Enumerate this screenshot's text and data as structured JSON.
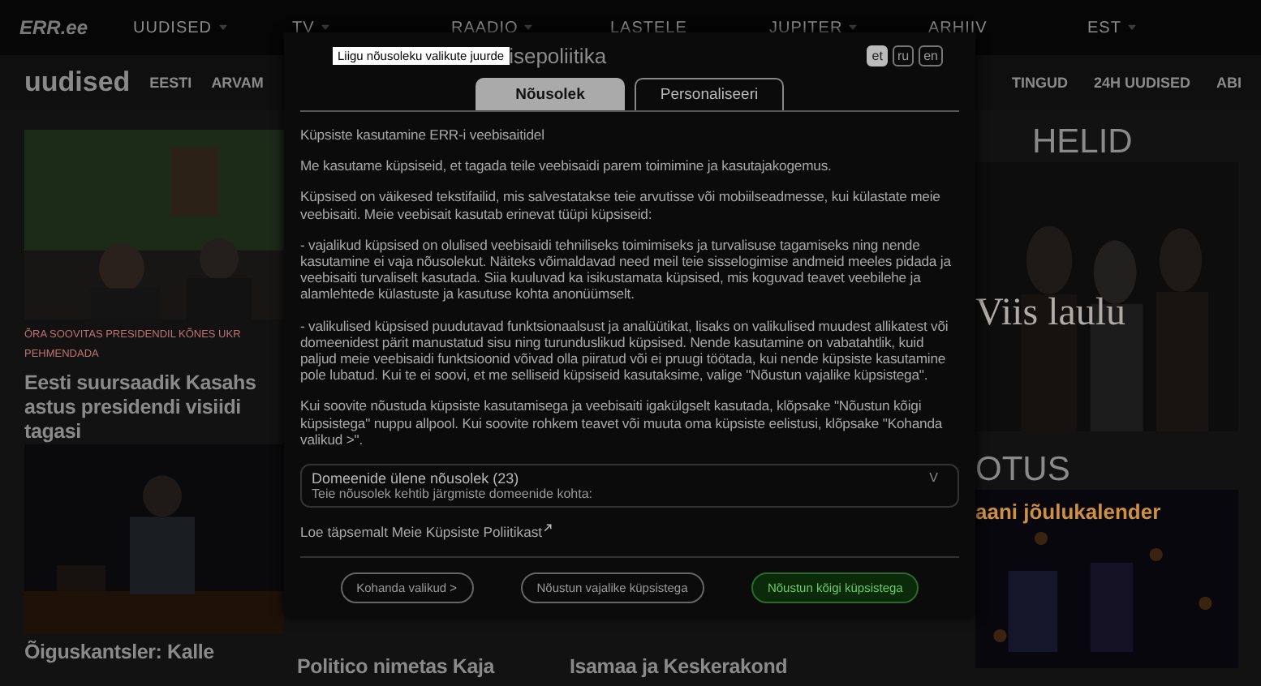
{
  "top_nav": {
    "logo": "ERR.ee",
    "items": [
      {
        "label": "UUDISED",
        "dropdown": true
      },
      {
        "label": "TV",
        "dropdown": true
      },
      {
        "label": "RAADIO",
        "dropdown": true
      },
      {
        "label": "LASTELE",
        "dropdown": false
      },
      {
        "label": "JUPITER",
        "dropdown": true
      },
      {
        "label": "ARHIIV",
        "dropdown": false
      },
      {
        "label": "EST",
        "dropdown": true
      }
    ]
  },
  "section_nav": {
    "title": "uudised",
    "left_items": [
      "EESTI",
      "ARVAM"
    ],
    "right_items": [
      "TINGUD",
      "24H UUDISED",
      "ABI"
    ]
  },
  "articles": {
    "column_1": [
      {
        "kind": "picture"
      },
      {
        "kind": "kicker",
        "text": "ÕRA SOOVITAS PRESIDENDIL KÕNES UKR PEHMENDADA"
      },
      {
        "kind": "headline",
        "text": "Eesti suursaadik Kasahs astus presidendi visiidi tagasi"
      },
      {
        "kind": "picture"
      },
      {
        "kind": "headline",
        "text": "Õiguskantsler: Kalle"
      }
    ],
    "column_2": [
      {
        "kind": "headline",
        "text": "Politico nimetas Kaja"
      }
    ],
    "column_3": [
      {
        "kind": "headline",
        "text": "Isamaa ja Keskerakond"
      }
    ],
    "column_4": [
      {
        "kind": "section",
        "text": "HELID"
      },
      {
        "kind": "picture",
        "caption": "Viis laulu"
      },
      {
        "kind": "section",
        "text": "OTUS"
      },
      {
        "kind": "picture",
        "caption": "aani jõulukalender"
      }
    ]
  },
  "cookie_dialog": {
    "skip_link": "Liigu nõusoleku valikute juurde",
    "title": "isepoliitika",
    "languages": [
      {
        "label": "et",
        "selected": true
      },
      {
        "label": "ru",
        "selected": false
      },
      {
        "label": "en",
        "selected": false
      }
    ],
    "tabs": [
      {
        "label": "Nõusolek",
        "selected": true
      },
      {
        "label": "Personaliseeri",
        "selected": false
      }
    ],
    "paragraphs": [
      "Küpsiste kasutamine ERR-i veebisaitidel",
      "Me kasutame küpsiseid, et tagada teile veebisaidi parem toimimine ja kasutajakogemus.",
      "Küpsised on väikesed tekstifailid, mis salvestatakse teie arvutisse või mobiilseadmesse, kui külastate meie veebisaiti. Meie veebisait kasutab erinevat tüüpi küpsiseid:",
      "- vajalikud küpsised on olulised veebisaidi tehniliseks toimimiseks ja turvalisuse tagamiseks ning nende kasutamine ei vaja nõusolekut. Näiteks võimaldavad need meil teie sisselogimise andmeid meeles pidada ja veebisaiti turvaliselt kasutada. Siia kuuluvad ka isikustamata küpsised, mis koguvad teavet veebilehe ja alamlehtede külastuste ja kasutuse kohta anonüümselt.",
      "- valikulised küpsised puudutavad funktsionaalsust ja analüütikat, lisaks on valikulised muudest allikatest või domeenidest pärit manustatud sisu ning turunduslikud küpsised. Nende kasutamine on vabatahtlik, kuid paljud meie veebisaidi funktsioonid võivad olla piiratud või ei pruugi töötada, kui nende küpsiste kasutamine pole lubatud. Kui te ei soovi, et me selliseid küpsiseid kasutaksime, valige \"Nõustun vajalike küpsistega\".",
      "Kui soovite nõustuda küpsiste kasutamisega ja veebisaiti igakülgselt kasutada, klõpsake \"Nõustun kõigi küpsistega\" nuppu allpool. Kui soovite rohkem teavet või muuta oma küpsiste eelistusi, klõpsake \"Kohanda valikud >\"."
    ],
    "domains": {
      "title": "Domeenide ülene nõusolek (23)",
      "subtitle": "Teie nõusolek kehtib järgmiste domeenide kohta:",
      "expander": "V",
      "expanded": false
    },
    "policy_link": "Loe täpsemalt Meie Küpsiste Poliitikast",
    "buttons": [
      {
        "label": "Kohanda valikud >",
        "kind": "outline"
      },
      {
        "label": "Nõustun vajalike küpsistega",
        "kind": "outline"
      },
      {
        "label": "Nõustun kõigi küpsistega",
        "kind": "primary"
      }
    ]
  }
}
